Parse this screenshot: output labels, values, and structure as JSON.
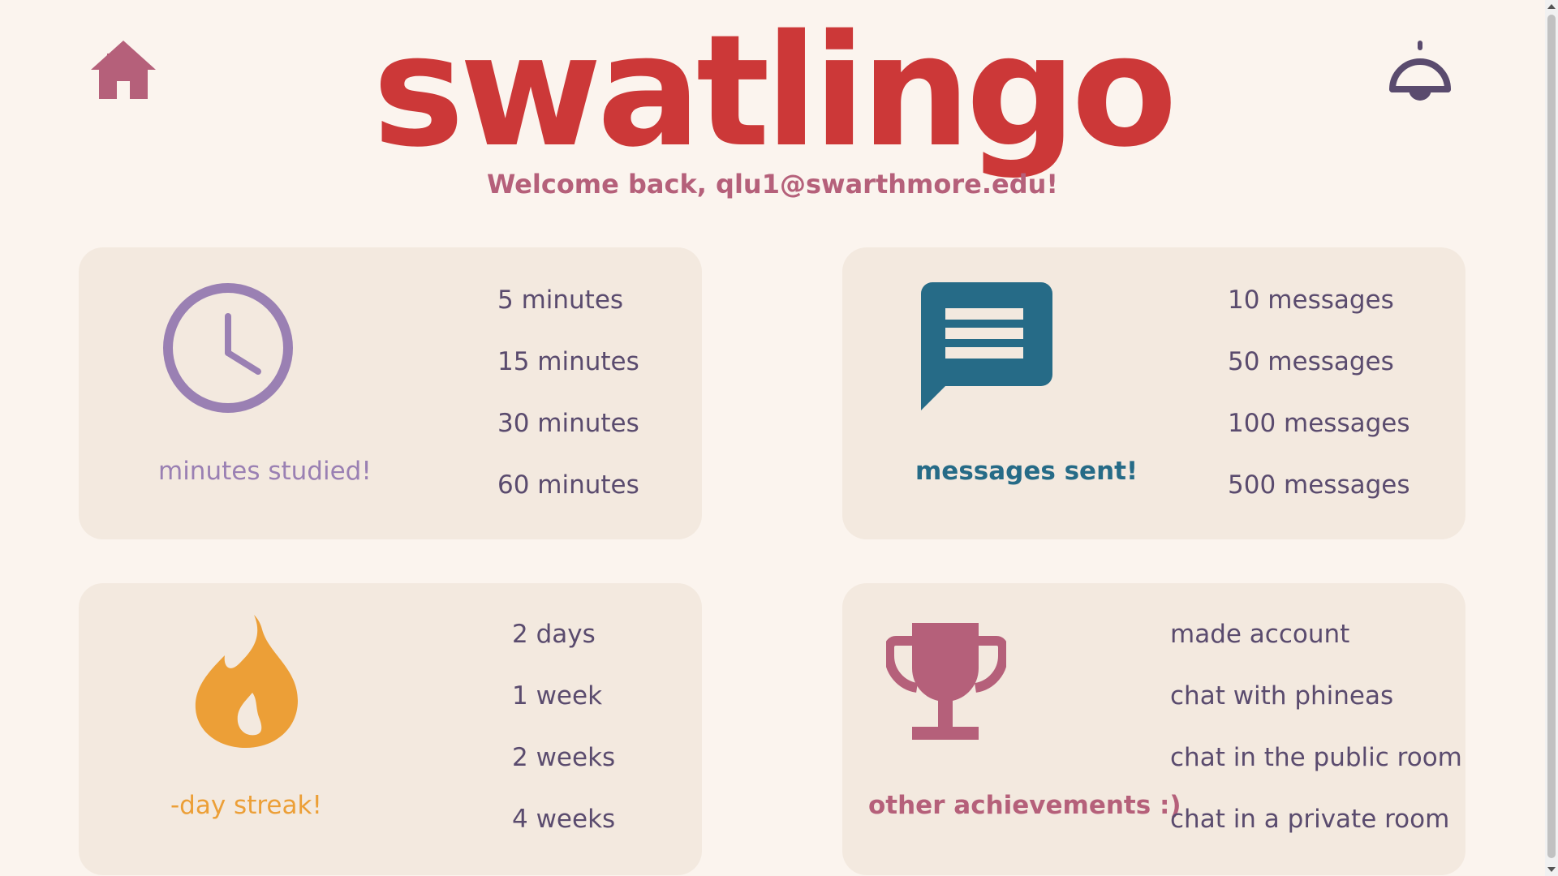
{
  "header": {
    "logo": "swatlingo",
    "welcome": "Welcome back, qlu1@swarthmore.edu!",
    "home_icon": "home-icon",
    "bell_icon": "bell-icon"
  },
  "cards": {
    "minutes": {
      "icon": "clock-icon",
      "caption": "minutes studied!",
      "color": "#9a80b3",
      "tiers": [
        "5 minutes",
        "15 minutes",
        "30 minutes",
        "60 minutes"
      ]
    },
    "messages": {
      "icon": "chat-bubble-icon",
      "caption": "messages sent!",
      "color": "#266b87",
      "tiers": [
        "10 messages",
        "50 messages",
        "100 messages",
        "500 messages"
      ]
    },
    "streak": {
      "icon": "flame-icon",
      "caption": "-day streak!",
      "color": "#ec9f37",
      "tiers": [
        "2 days",
        "1 week",
        "2 weeks",
        "4 weeks"
      ]
    },
    "achievements": {
      "icon": "trophy-icon",
      "caption": "other achievements :)",
      "color": "#b5607a",
      "tiers": [
        "made account",
        "chat with phineas",
        "chat in the public room",
        "chat in a private room"
      ]
    }
  },
  "colors": {
    "background": "#fbf4ee",
    "card": "#f3e9df",
    "logo": "#cc3838",
    "tier_text": "#5a4b6e"
  }
}
